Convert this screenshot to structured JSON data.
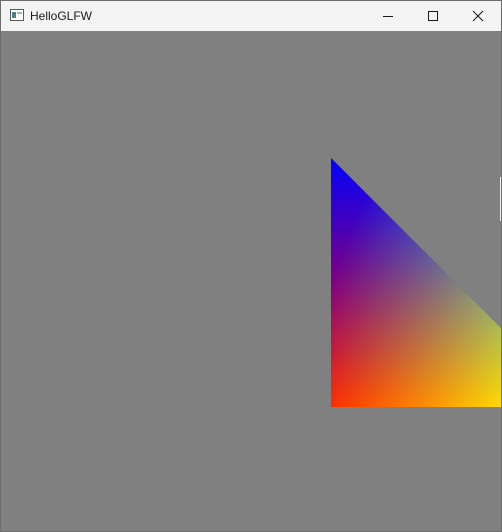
{
  "window": {
    "title": "HelloGLFW",
    "clear_color": "#808080"
  },
  "titlebar": {
    "app_icon": "window-app-icon",
    "controls": [
      {
        "name": "minimize-button",
        "icon": "minimize-icon"
      },
      {
        "name": "maximize-button",
        "icon": "maximize-icon"
      },
      {
        "name": "close-button",
        "icon": "close-icon"
      }
    ]
  },
  "scene": {
    "triangle": {
      "vertex_colors": [
        "#0000ff",
        "#ff0000",
        "#00ff00"
      ]
    }
  }
}
